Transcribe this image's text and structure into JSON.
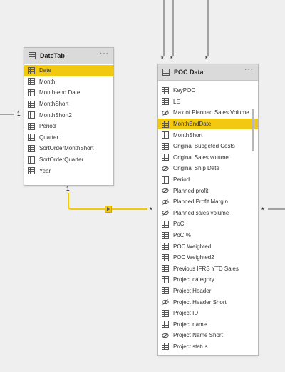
{
  "colors": {
    "accent": "#f2c811",
    "line": "#555555",
    "canvas": "#efefef"
  },
  "date_table": {
    "title": "DateTab",
    "more": "···",
    "fields": [
      {
        "label": "Date",
        "icon": "table-icon",
        "selected": true
      },
      {
        "label": "Month",
        "icon": "table-icon"
      },
      {
        "label": "Month-end Date",
        "icon": "table-icon"
      },
      {
        "label": "MonthShort",
        "icon": "table-icon"
      },
      {
        "label": "MonthShort2",
        "icon": "table-icon"
      },
      {
        "label": "Period",
        "icon": "table-icon"
      },
      {
        "label": "Quarter",
        "icon": "table-icon"
      },
      {
        "label": "SortOrderMonthShort",
        "icon": "table-icon"
      },
      {
        "label": "SortOrderQuarter",
        "icon": "table-icon"
      },
      {
        "label": "Year",
        "icon": "table-icon"
      }
    ]
  },
  "poc_table": {
    "title": "POC Data",
    "more": "···",
    "fields": [
      {
        "label": "KeyPOC",
        "icon": "table-icon"
      },
      {
        "label": "LE",
        "icon": "table-icon"
      },
      {
        "label": "Max of Planned Sales Volume",
        "icon": "hidden-icon"
      },
      {
        "label": "MonthEndDate",
        "icon": "table-icon",
        "selected": true
      },
      {
        "label": "MonthShort",
        "icon": "table-icon"
      },
      {
        "label": "Original Budgeted Costs",
        "icon": "table-icon"
      },
      {
        "label": "Original Sales volume",
        "icon": "table-icon"
      },
      {
        "label": "Original Ship Date",
        "icon": "hidden-icon"
      },
      {
        "label": "Period",
        "icon": "table-icon"
      },
      {
        "label": "Planned profit",
        "icon": "hidden-icon"
      },
      {
        "label": "Planned Profit Margin",
        "icon": "hidden-icon"
      },
      {
        "label": "Planned sales volume",
        "icon": "hidden-icon"
      },
      {
        "label": "PoC",
        "icon": "table-icon"
      },
      {
        "label": "PoC %",
        "icon": "table-icon"
      },
      {
        "label": "POC Weighted",
        "icon": "table-icon"
      },
      {
        "label": "POC Weighted2",
        "icon": "table-icon"
      },
      {
        "label": "Previous IFRS YTD Sales",
        "icon": "table-icon"
      },
      {
        "label": "Project category",
        "icon": "table-icon"
      },
      {
        "label": "Project Header",
        "icon": "table-icon"
      },
      {
        "label": "Project Header Short",
        "icon": "hidden-icon"
      },
      {
        "label": "Project ID",
        "icon": "table-icon"
      },
      {
        "label": "Project name",
        "icon": "table-icon"
      },
      {
        "label": "Project Name Short",
        "icon": "hidden-icon"
      },
      {
        "label": "Project status",
        "icon": "table-icon"
      }
    ]
  },
  "relationship": {
    "from_label": "1",
    "to_label": "*"
  },
  "other_relationships": {
    "left_one": "1",
    "top_stars": [
      "*",
      "*",
      "*"
    ],
    "right_star": "*"
  }
}
